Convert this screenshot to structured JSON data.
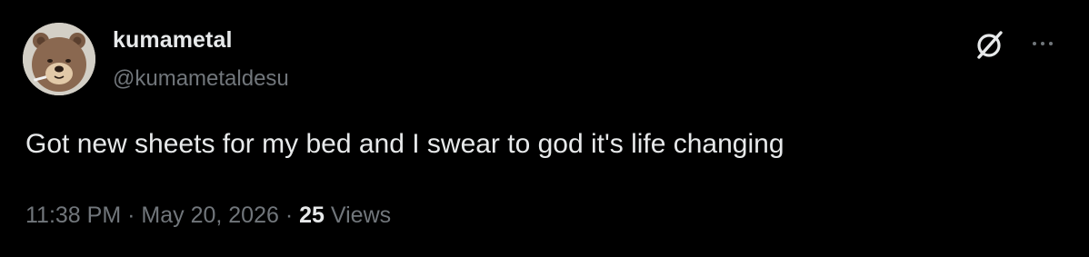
{
  "author": {
    "display_name": "kumametal",
    "handle": "@kumametaldesu",
    "avatar_icon": "bear-avatar"
  },
  "tweet": {
    "text": "Got new sheets for my bed and I swear to god it's life changing"
  },
  "meta": {
    "time": "11:38 PM",
    "separator": "·",
    "date": "May 20, 2026",
    "views_count": "25",
    "views_label": "Views"
  },
  "actions": {
    "grok_icon": "grok-icon",
    "more_icon": "more-options-icon"
  },
  "colors": {
    "background": "#000000",
    "primary_text": "#e7e9ea",
    "secondary_text": "#71767b"
  }
}
